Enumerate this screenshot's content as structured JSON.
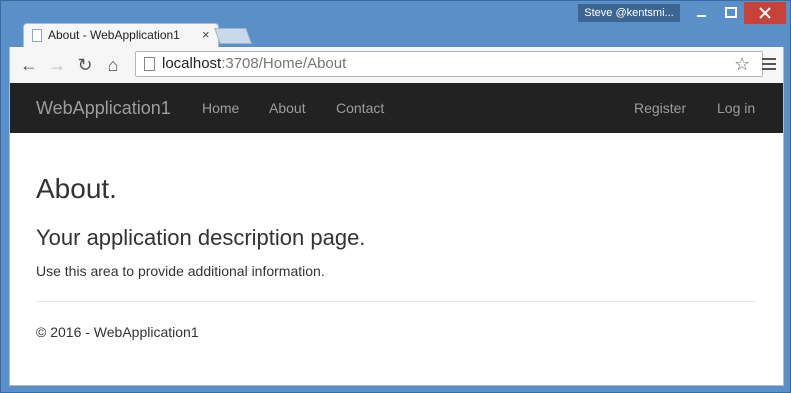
{
  "window": {
    "user": "Steve @kentsmi...",
    "minimize": "–",
    "maximize": "☐",
    "close": "✕"
  },
  "tab": {
    "title": "About - WebApplication1",
    "close": "×"
  },
  "toolbar": {
    "back": "←",
    "forward": "→",
    "reload": "↻",
    "home": "⌂",
    "url_host": "localhost",
    "url_rest": ":3708/Home/About",
    "star": "☆"
  },
  "navbar": {
    "brand": "WebApplication1",
    "links": [
      "Home",
      "About",
      "Contact"
    ],
    "right_links": [
      "Register",
      "Log in"
    ]
  },
  "page": {
    "title": "About.",
    "subtitle": "Your application description page.",
    "paragraph": "Use this area to provide additional information.",
    "footer": "© 2016 - WebApplication1"
  },
  "colors": {
    "navbar_bg": "#222222",
    "navbar_text": "#9d9d9d",
    "window_frame": "#5b8fc7",
    "close_button": "#c7433a"
  }
}
